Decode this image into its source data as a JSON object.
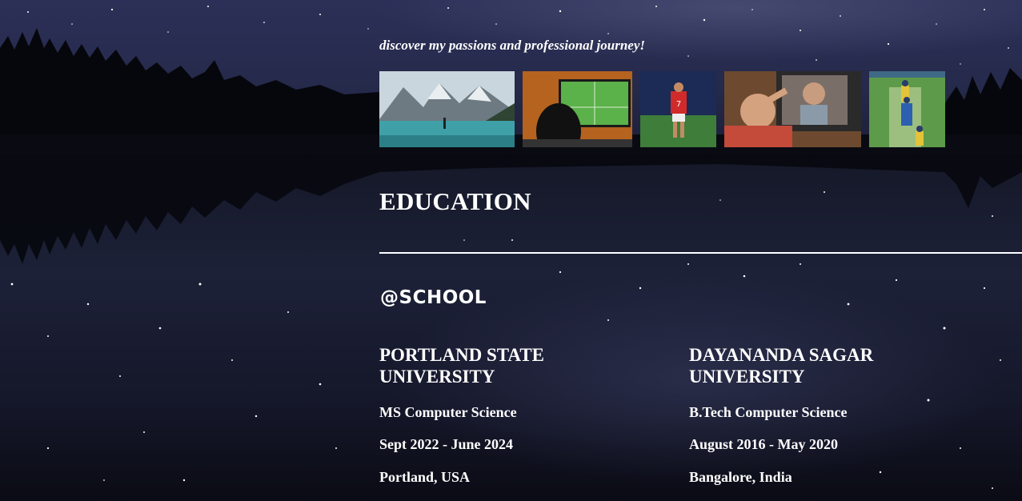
{
  "hero": {
    "tagline": "discover my passions and professional journey!"
  },
  "gallery": {
    "images": [
      {
        "name": "mountain-lake-photo"
      },
      {
        "name": "watching-football-photo"
      },
      {
        "name": "footballer-number-7-photo"
      },
      {
        "name": "sitcom-tv-scene-photo"
      },
      {
        "name": "cricket-match-photo"
      }
    ]
  },
  "education": {
    "title": "EDUCATION",
    "subtitle": "@SCHOOL",
    "schools": [
      {
        "name": "PORTLAND STATE UNIVERSITY",
        "degree": "MS Computer Science",
        "dates": "Sept 2022 - June 2024",
        "location": "Portland, USA"
      },
      {
        "name": "DAYANANDA SAGAR UNIVERSITY",
        "degree": "B.Tech Computer Science",
        "dates": "August 2016 - May 2020",
        "location": "Bangalore, India"
      }
    ]
  },
  "theme": {
    "text_color": "#ffffff",
    "sky_color": "#262a4a",
    "water_color": "#1a1d33"
  }
}
